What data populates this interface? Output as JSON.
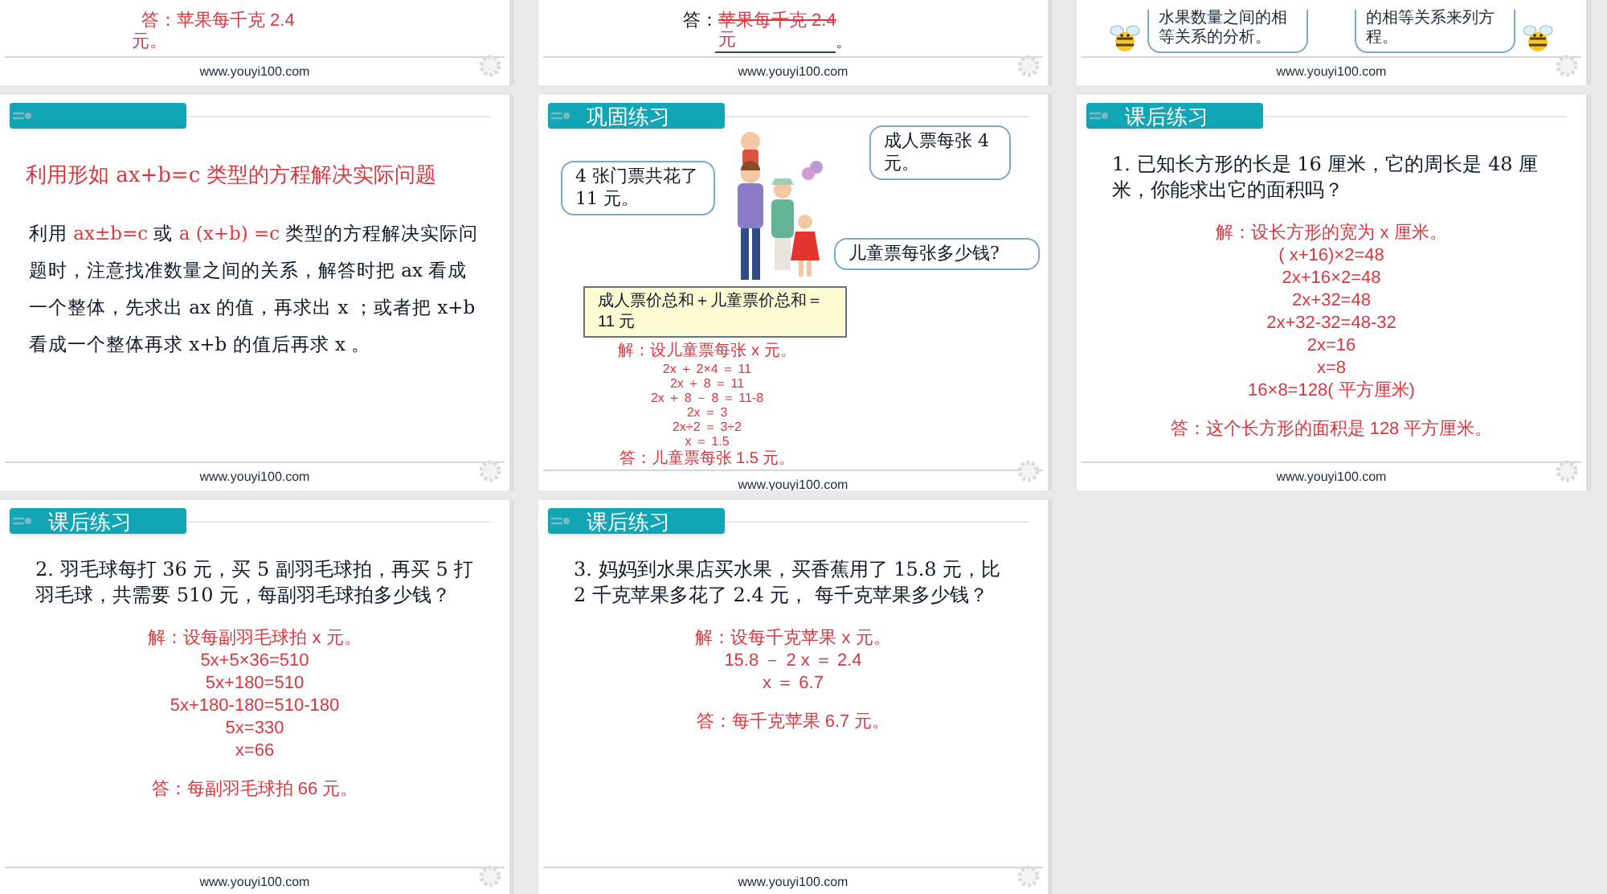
{
  "rows": [
    {
      "slides": [
        {
          "kind": "answer_tail",
          "lines": [
            "答：苹果每千克 2.4",
            "元。"
          ],
          "footer": "www.youyi100.com"
        },
        {
          "kind": "fill_answer",
          "prefix": "答：",
          "answer": "苹果每千克 2.4",
          "unit": "元",
          "end": "。",
          "footer": "www.youyi100.com"
        },
        {
          "kind": "bee_tips",
          "tips": [
            {
              "lines": [
                "水果数量之间的相",
                "等关系的分析。"
              ]
            },
            {
              "lines": [
                "的相等关系来列方",
                "程。"
              ]
            }
          ],
          "footer": "www.youyi100.com"
        }
      ]
    },
    {
      "slides": [
        {
          "kind": "concept",
          "title": "利用形如 ax+b=c 类型的方程解决实际问题",
          "paragraph": [
            {
              "text": "利用 ",
              "highlight": false
            },
            {
              "text": "ax±b=c",
              "highlight": true
            },
            {
              "text": " 或 ",
              "highlight": false
            },
            {
              "text": "a (x+b) =c",
              "highlight": true
            },
            {
              "text": " 类型的方程解决实际问题时，注意找准数量之间的关系，解答时把 ax 看成一个整体，先求出 ax 的值，再求出 x ；或者把 x+b 看成一个整体再求 x+b 的值后再求 x 。",
              "highlight": false
            }
          ],
          "footer": "www.youyi100.com"
        },
        {
          "kind": "illustrated",
          "tab": "巩固练习",
          "top_bubble": "成人票每张 4 元。",
          "left_bubble": "4 张门票共花了 11 元。",
          "bottom_bubble": "儿童票每张多少钱?",
          "relation": "成人票价总和＋儿童票价总和＝ 11 元",
          "solution": [
            "解：设儿童票每张 x 元。",
            "2x ＋ 2×4 ＝ 11",
            "2x ＋ 8 ＝ 11",
            "2x ＋ 8 － 8 ＝ 11-8",
            "2x ＝ 3",
            "2x÷2 ＝ 3÷2",
            "x ＝ 1.5"
          ],
          "answer": "答：儿童票每张 1.5 元。",
          "footer": "www.youyi100.com"
        },
        {
          "kind": "exercise",
          "tab": "课后练习",
          "question": "1. 已知长方形的长是 16 厘米，它的周长是 48 厘米，你能求出它的面积吗？",
          "solution": [
            "解：设长方形的宽为 x 厘米。",
            "( x+16)×2=48",
            "2x+16×2=48",
            "2x+32=48",
            "2x+32-32=48-32",
            "2x=16",
            "x=8",
            "16×8=128( 平方厘米)"
          ],
          "answer": "答：这个长方形的面积是 128 平方厘米。",
          "footer": "www.youyi100.com"
        }
      ]
    },
    {
      "slides": [
        {
          "kind": "exercise",
          "tab": "课后练习",
          "question": "2. 羽毛球每打 36 元，买 5 副羽毛球拍，再买 5 打羽毛球，共需要 510 元，每副羽毛球拍多少钱？",
          "solution": [
            "解：设每副羽毛球拍 x 元。",
            "5x+5×36=510",
            "5x+180=510",
            "5x+180-180=510-180",
            "5x=330",
            "x=66"
          ],
          "answer": "答：每副羽毛球拍 66 元。",
          "footer": "www.youyi100.com"
        },
        {
          "kind": "exercise",
          "tab": "课后练习",
          "question": "3. 妈妈到水果店买水果，买香蕉用了 15.8 元，比 2 千克苹果多花了 2.4 元， 每千克苹果多少钱？",
          "solution": [
            "解：设每千克苹果 x 元。",
            "15.8 － 2 x ＝ 2.4",
            "x ＝ 6.7"
          ],
          "answer": "答：每千克苹果 6.7 元。",
          "footer": "www.youyi100.com"
        }
      ]
    }
  ]
}
